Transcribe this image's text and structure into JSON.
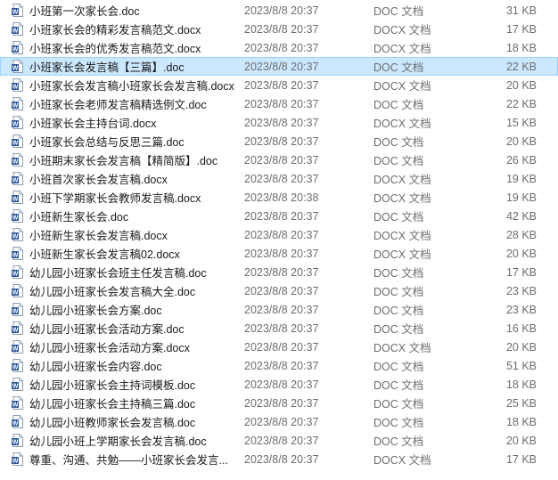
{
  "files": [
    {
      "name": "小班第一次家长会.doc",
      "modified": "2023/8/8 20:37",
      "type": "DOC 文档",
      "size": "31 KB"
    },
    {
      "name": "小班家长会的精彩发言稿范文.docx",
      "modified": "2023/8/8 20:37",
      "type": "DOCX 文档",
      "size": "17 KB"
    },
    {
      "name": "小班家长会的优秀发言稿范文.docx",
      "modified": "2023/8/8 20:37",
      "type": "DOCX 文档",
      "size": "18 KB"
    },
    {
      "name": "小班家长会发言稿【三篇】.doc",
      "modified": "2023/8/8 20:37",
      "type": "DOC 文档",
      "size": "22 KB",
      "selected": true
    },
    {
      "name": "小班家长会发言稿小班家长会发言稿.docx",
      "modified": "2023/8/8 20:37",
      "type": "DOCX 文档",
      "size": "20 KB"
    },
    {
      "name": "小班家长会老师发言稿精选例文.doc",
      "modified": "2023/8/8 20:37",
      "type": "DOC 文档",
      "size": "22 KB"
    },
    {
      "name": "小班家长会主持台词.docx",
      "modified": "2023/8/8 20:37",
      "type": "DOCX 文档",
      "size": "15 KB"
    },
    {
      "name": "小班家长会总结与反思三篇.doc",
      "modified": "2023/8/8 20:37",
      "type": "DOC 文档",
      "size": "20 KB"
    },
    {
      "name": "小班期末家长会发言稿【精简版】.doc",
      "modified": "2023/8/8 20:37",
      "type": "DOC 文档",
      "size": "26 KB"
    },
    {
      "name": "小班首次家长会发言稿.docx",
      "modified": "2023/8/8 20:37",
      "type": "DOCX 文档",
      "size": "19 KB"
    },
    {
      "name": "小班下学期家长会教师发言稿.docx",
      "modified": "2023/8/8 20:38",
      "type": "DOCX 文档",
      "size": "19 KB"
    },
    {
      "name": "小班新生家长会.doc",
      "modified": "2023/8/8 20:37",
      "type": "DOC 文档",
      "size": "42 KB"
    },
    {
      "name": "小班新生家长会发言稿.docx",
      "modified": "2023/8/8 20:37",
      "type": "DOCX 文档",
      "size": "28 KB"
    },
    {
      "name": "小班新生家长会发言稿02.docx",
      "modified": "2023/8/8 20:37",
      "type": "DOCX 文档",
      "size": "20 KB"
    },
    {
      "name": "幼儿园小班家长会班主任发言稿.doc",
      "modified": "2023/8/8 20:37",
      "type": "DOC 文档",
      "size": "17 KB"
    },
    {
      "name": "幼儿园小班家长会发言稿大全.doc",
      "modified": "2023/8/8 20:37",
      "type": "DOC 文档",
      "size": "23 KB"
    },
    {
      "name": "幼儿园小班家长会方案.doc",
      "modified": "2023/8/8 20:37",
      "type": "DOC 文档",
      "size": "23 KB"
    },
    {
      "name": "幼儿园小班家长会活动方案.doc",
      "modified": "2023/8/8 20:37",
      "type": "DOC 文档",
      "size": "16 KB"
    },
    {
      "name": "幼儿园小班家长会活动方案.docx",
      "modified": "2023/8/8 20:37",
      "type": "DOCX 文档",
      "size": "20 KB"
    },
    {
      "name": "幼儿园小班家长会内容.doc",
      "modified": "2023/8/8 20:37",
      "type": "DOC 文档",
      "size": "51 KB"
    },
    {
      "name": "幼儿园小班家长会主持词模板.doc",
      "modified": "2023/8/8 20:37",
      "type": "DOC 文档",
      "size": "18 KB"
    },
    {
      "name": "幼儿园小班家长会主持稿三篇.doc",
      "modified": "2023/8/8 20:37",
      "type": "DOC 文档",
      "size": "25 KB"
    },
    {
      "name": "幼儿园小班教师家长会发言稿.doc",
      "modified": "2023/8/8 20:37",
      "type": "DOC 文档",
      "size": "18 KB"
    },
    {
      "name": "幼儿园小班上学期家长会发言稿.doc",
      "modified": "2023/8/8 20:37",
      "type": "DOC 文档",
      "size": "20 KB"
    },
    {
      "name": "尊重、沟通、共勉——小班家长会发言...",
      "modified": "2023/8/8 20:37",
      "type": "DOCX 文档",
      "size": "17 KB"
    }
  ],
  "icons": {
    "doc": "word-doc-icon",
    "docx": "word-docx-icon"
  },
  "colors": {
    "selection": "#cce8ff",
    "word_blue": "#2b579a"
  }
}
